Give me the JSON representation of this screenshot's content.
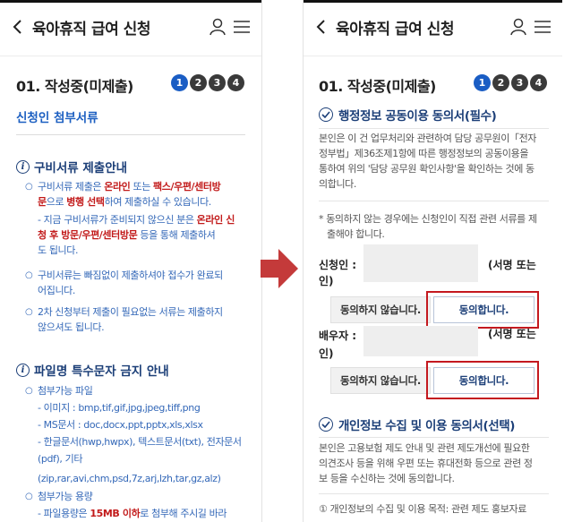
{
  "header": {
    "title": "육아휴직 급여 신청"
  },
  "steps": {
    "title": "01. 작성중(미제출)",
    "numbers": [
      "1",
      "2",
      "3",
      "4"
    ]
  },
  "left": {
    "section_heading": "신청인 첨부서류",
    "notice1": {
      "title": "구비서류 제출안내",
      "b1_a": "구비서류 제출은 ",
      "b1_b": "온라인",
      "b1_c": " 또는 ",
      "b1_d": "팩스/우편/센터방",
      "b1_e": "문",
      "b1_f": "으로 ",
      "b1_g": "병행 선택",
      "b1_h": "하여 제출하실 수 있습니다.",
      "b2_a": "- 지금 구비서류가 준비되지 않으신 분은 ",
      "b2_b": "온라인 신",
      "b2_c": "청 후 방문/우편/센터방문",
      "b2_d": " 등을 통해 제출하셔",
      "b2_e": "도 됩니다.",
      "b3_l1": "구비서류는 빠짐없이 제출하셔야 접수가 완료되",
      "b3_l2": "어집니다.",
      "b4_l1": "2차 신청부터 제출이 필요없는 서류는 제출하지",
      "b4_l2": "않으셔도 됩니다."
    },
    "notice2": {
      "title": "파일명 특수문자 금지 안내",
      "l1": "첨부가능 파일",
      "l2": "- 이미지 : bmp,tif,gif,jpg,jpeg,tiff,png",
      "l3": "- MS문서 : doc,docx,ppt,pptx,xls,xlsx",
      "l4": "- 한글문서(hwp,hwpx), 텍스트문서(txt), 전자문서",
      "l5": "(pdf), 기타",
      "l6": "(zip,rar,avi,chm,psd,7z,arj,lzh,tar,gz,alz)",
      "l7": "첨부가능 용량",
      "l8_a": "- 파일용량은 ",
      "l8_b": "15MB 이하",
      "l8_c": "로 첨부해 주시길 바라"
    }
  },
  "right": {
    "consent1": {
      "title": "행정정보 공동이용 동의서(필수)",
      "p1": "본인은 이 건 업무처리와 관련하여 담당 공무원이「전자",
      "p2": "정부법」제36조제1항에 따른 행정정보의 공동이용을",
      "p3": "통하여 위의 '담당 공무원 확인사항'을 확인하는 것에 동",
      "p4": "의합니다.",
      "note1": "* 동의하지 않는 경우에는 신청인이 직접 관련 서류를 제",
      "note2": "출해야 합니다.",
      "applicant_label": "신청인 :",
      "applicant_tail": "(서명 또는",
      "applicant_tail2": "인)",
      "disagree": "동의하지 않습니다.",
      "agree": "동의합니다.",
      "spouse_label": "배우자 :",
      "spouse_tail": "(서명 또는",
      "spouse_tail2": "인)",
      "disagree2": "동의하지 않습니다.",
      "agree2": "동의합니다."
    },
    "consent2": {
      "title": "개인정보 수집 및 이용 동의서(선택)",
      "p1": "본인은 고용보험 제도 안내 및 관련 제도개선에 필요한",
      "p2": "의견조사 등을 위해 우편 또는 휴대전화 등으로 관련 정",
      "p3": "보 등을 수신하는 것에 동의합니다.",
      "p4": "① 개인정보의 수집 및 이용 목적: 관련 제도 홍보자료"
    }
  },
  "colors": {
    "accent": "#1a5dc4",
    "heading": "#1c3f78",
    "highlight": "#c4191f",
    "arrow": "#c43a3a"
  }
}
